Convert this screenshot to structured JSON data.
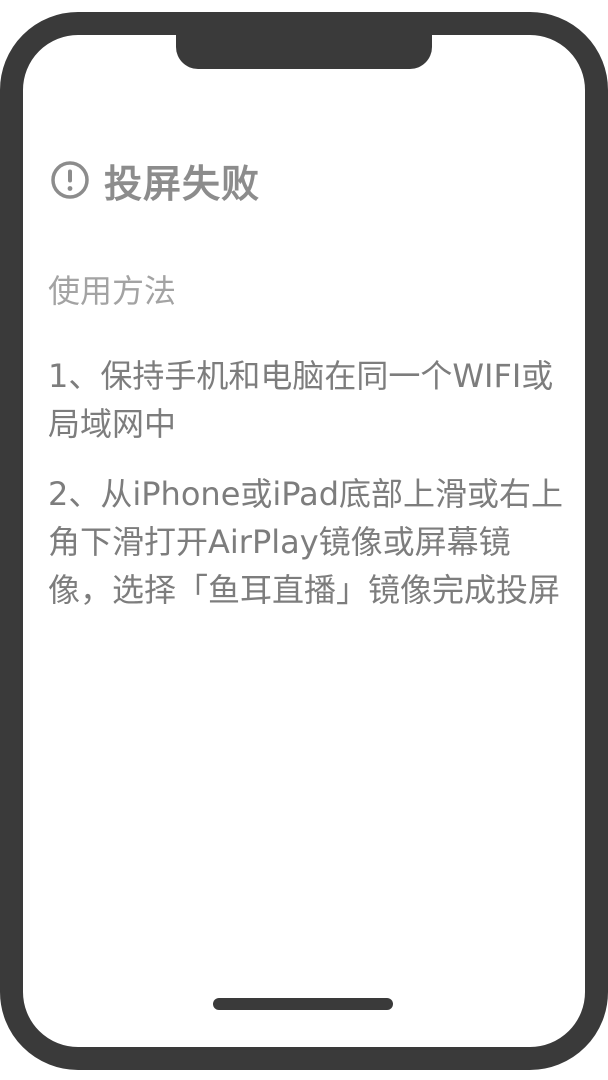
{
  "error": {
    "title": "投屏失败",
    "icon": "exclamation-circle-icon"
  },
  "instructions": {
    "heading": "使用方法",
    "steps": [
      "1、保持手机和电脑在同一个WIFI或局域网中",
      "2、从iPhone或iPad底部上滑或右上角下滑打开AirPlay镜像或屏幕镜像，选择「鱼耳直播」镜像完成投屏"
    ]
  },
  "colors": {
    "frame": "#3a3a3a",
    "title": "#8c8c8c",
    "heading": "#a3a3a3",
    "body": "#7d7d7d"
  }
}
